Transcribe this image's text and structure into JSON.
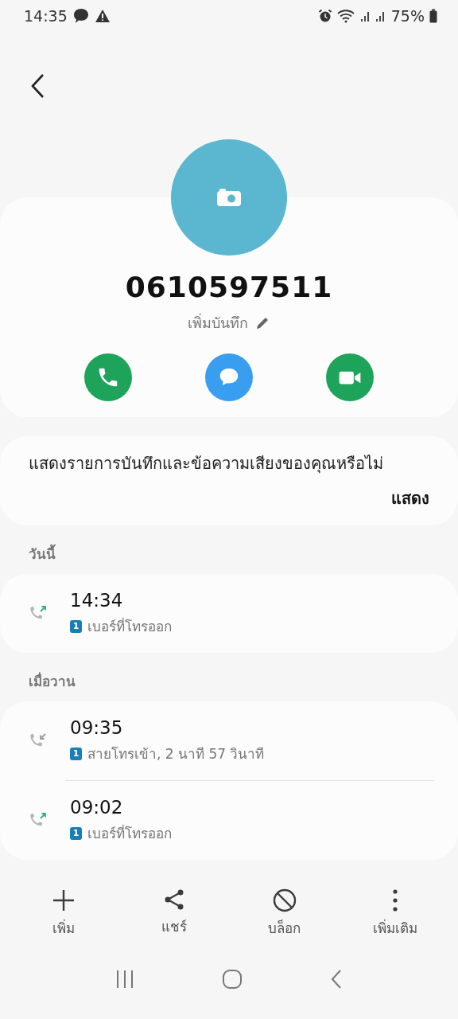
{
  "status_bar": {
    "time": "14:35",
    "battery": "75%"
  },
  "contact": {
    "number": "0610597511",
    "note": "เพิ่มบันทึก"
  },
  "actions": [
    {
      "kind": "call"
    },
    {
      "kind": "message"
    },
    {
      "kind": "video"
    }
  ],
  "prompt": {
    "text": "แสดงรายการบันทึกและข้อความเสียงของคุณหรือไม่",
    "button": "แสดง"
  },
  "groups": [
    {
      "title": "วันนี้",
      "calls": [
        {
          "kind": "outgoing",
          "time": "14:34",
          "sim": "1",
          "detail": "เบอร์ที่โทรออก"
        }
      ]
    },
    {
      "title": "เมื่อวาน",
      "calls": [
        {
          "kind": "incoming",
          "time": "09:35",
          "sim": "1",
          "detail": "สายโทรเข้า, 2 นาที 57 วินาที"
        },
        {
          "kind": "outgoing",
          "time": "09:02",
          "sim": "1",
          "detail": "เบอร์ที่โทรออก"
        }
      ]
    }
  ],
  "toolbar": [
    {
      "kind": "add",
      "label": "เพิ่ม"
    },
    {
      "kind": "share",
      "label": "แชร์"
    },
    {
      "kind": "block",
      "label": "บล็อก"
    },
    {
      "kind": "more",
      "label": "เพิ่มเติม"
    }
  ]
}
